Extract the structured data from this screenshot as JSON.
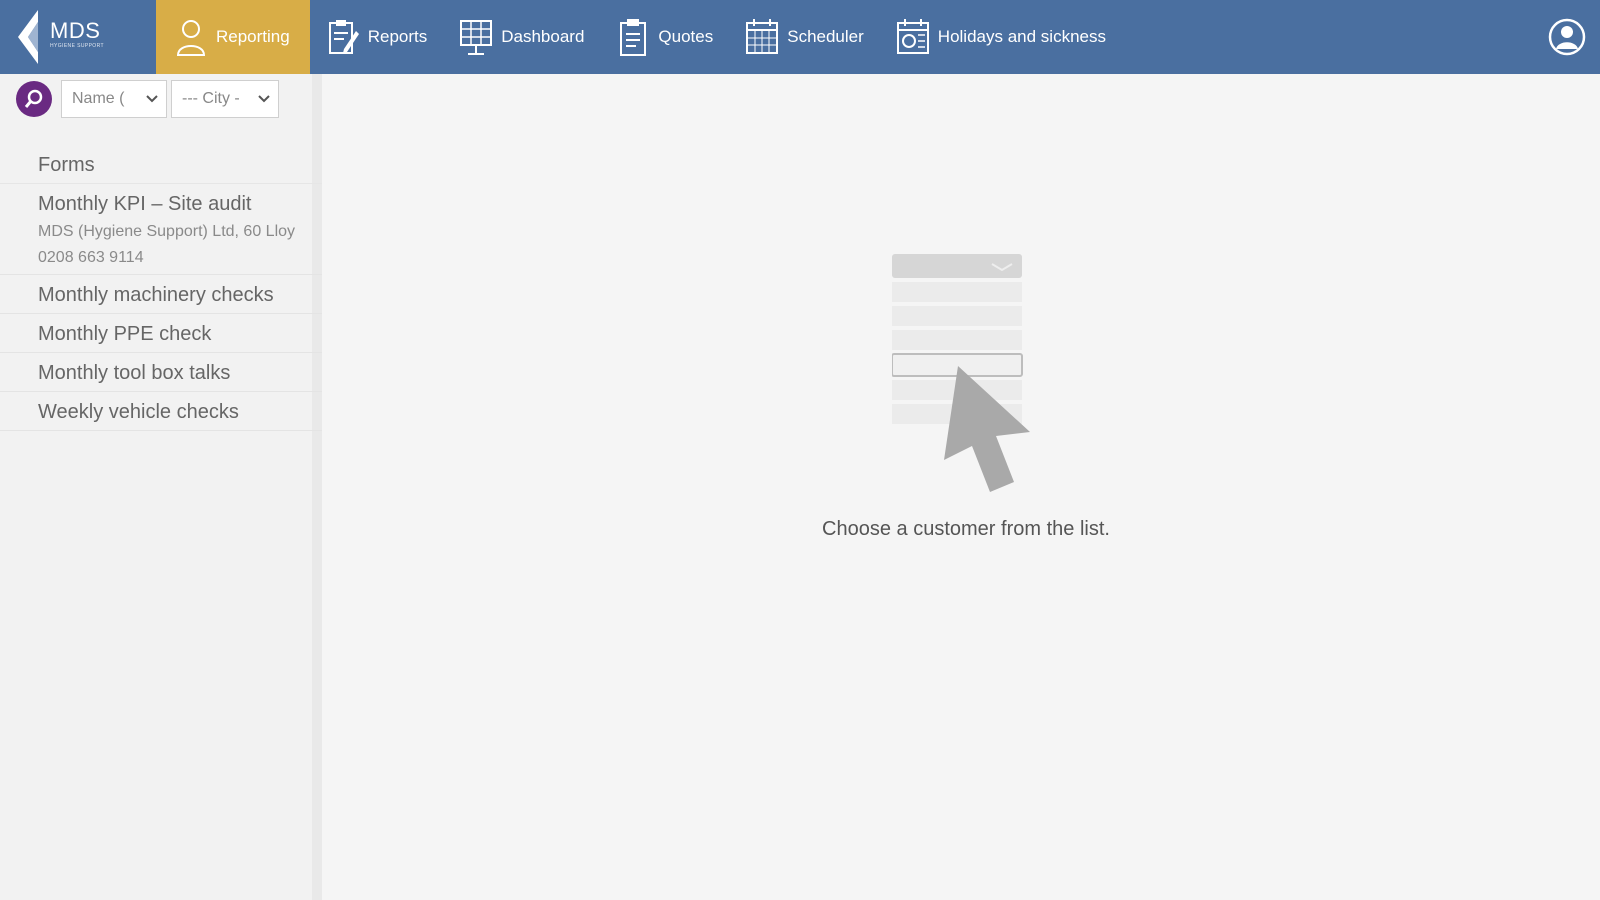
{
  "header": {
    "logo_text": "MDS",
    "logo_subtext": "HYGIENE SUPPORT",
    "nav": [
      {
        "label": "Reporting",
        "icon": "person-icon",
        "active": true
      },
      {
        "label": "Reports",
        "icon": "report-edit-icon",
        "active": false
      },
      {
        "label": "Dashboard",
        "icon": "dashboard-icon",
        "active": false
      },
      {
        "label": "Quotes",
        "icon": "clipboard-icon",
        "active": false
      },
      {
        "label": "Scheduler",
        "icon": "calendar-icon",
        "active": false
      },
      {
        "label": "Holidays and sickness",
        "icon": "holiday-calendar-icon",
        "active": false
      }
    ],
    "colors": {
      "bar": "#4a6fa0",
      "active": "#d8ad47"
    }
  },
  "filters": {
    "name_select": "Name (",
    "city_select": "--- City -"
  },
  "sidebar": {
    "section_title": "Forms",
    "items": [
      {
        "title": "Monthly KPI – Site audit",
        "meta": "MDS (Hygiene Support) Ltd, 60 Lloy",
        "phone": "0208 663 9114"
      },
      {
        "title": "Monthly machinery checks"
      },
      {
        "title": "Monthly PPE check"
      },
      {
        "title": "Monthly tool box talks"
      },
      {
        "title": "Weekly vehicle checks"
      }
    ]
  },
  "main": {
    "empty_message": "Choose a customer from the list."
  }
}
